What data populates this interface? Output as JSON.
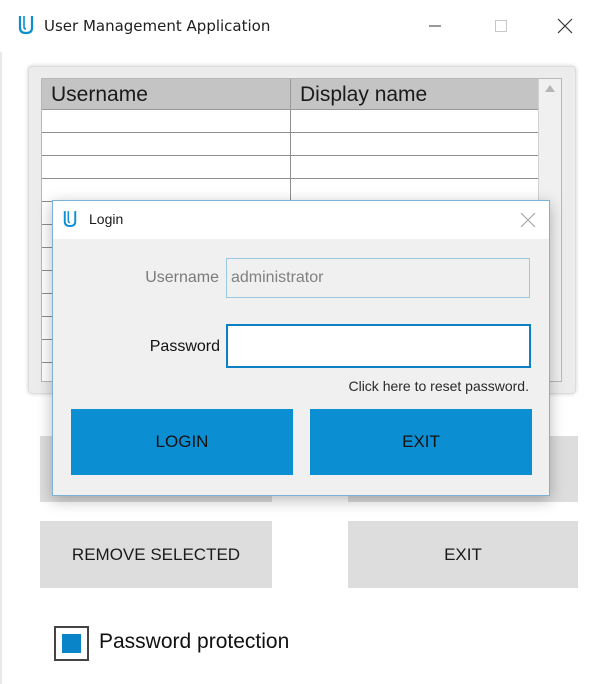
{
  "window": {
    "title": "User Management Application",
    "icon": "app-logo-icon",
    "controls": [
      "minimize-icon",
      "maximize-icon",
      "close-icon"
    ]
  },
  "table": {
    "columns": [
      "Username",
      "Display name"
    ],
    "rows": [
      [
        "",
        ""
      ],
      [
        "",
        ""
      ],
      [
        "",
        ""
      ],
      [
        "",
        ""
      ],
      [
        "",
        ""
      ],
      [
        "",
        ""
      ],
      [
        "",
        ""
      ],
      [
        "",
        ""
      ],
      [
        "",
        ""
      ],
      [
        "",
        ""
      ],
      [
        "",
        ""
      ],
      [
        "",
        ""
      ]
    ]
  },
  "main_buttons": {
    "remove_selected": "REMOVE SELECTED",
    "exit": "EXIT"
  },
  "password_protection": {
    "label": "Password protection",
    "checked": true
  },
  "login_dialog": {
    "title": "Login",
    "icon": "app-logo-icon",
    "username_label": "Username",
    "username_value": "administrator",
    "password_label": "Password",
    "password_value": "",
    "reset_link": "Click here to reset password.",
    "login_button": "LOGIN",
    "exit_button": "EXIT"
  },
  "colors": {
    "accent": "#0b8fd2",
    "button_gray": "#dddddd",
    "table_header": "#c4c4c4",
    "dialog_border": "#7bb2d6"
  }
}
